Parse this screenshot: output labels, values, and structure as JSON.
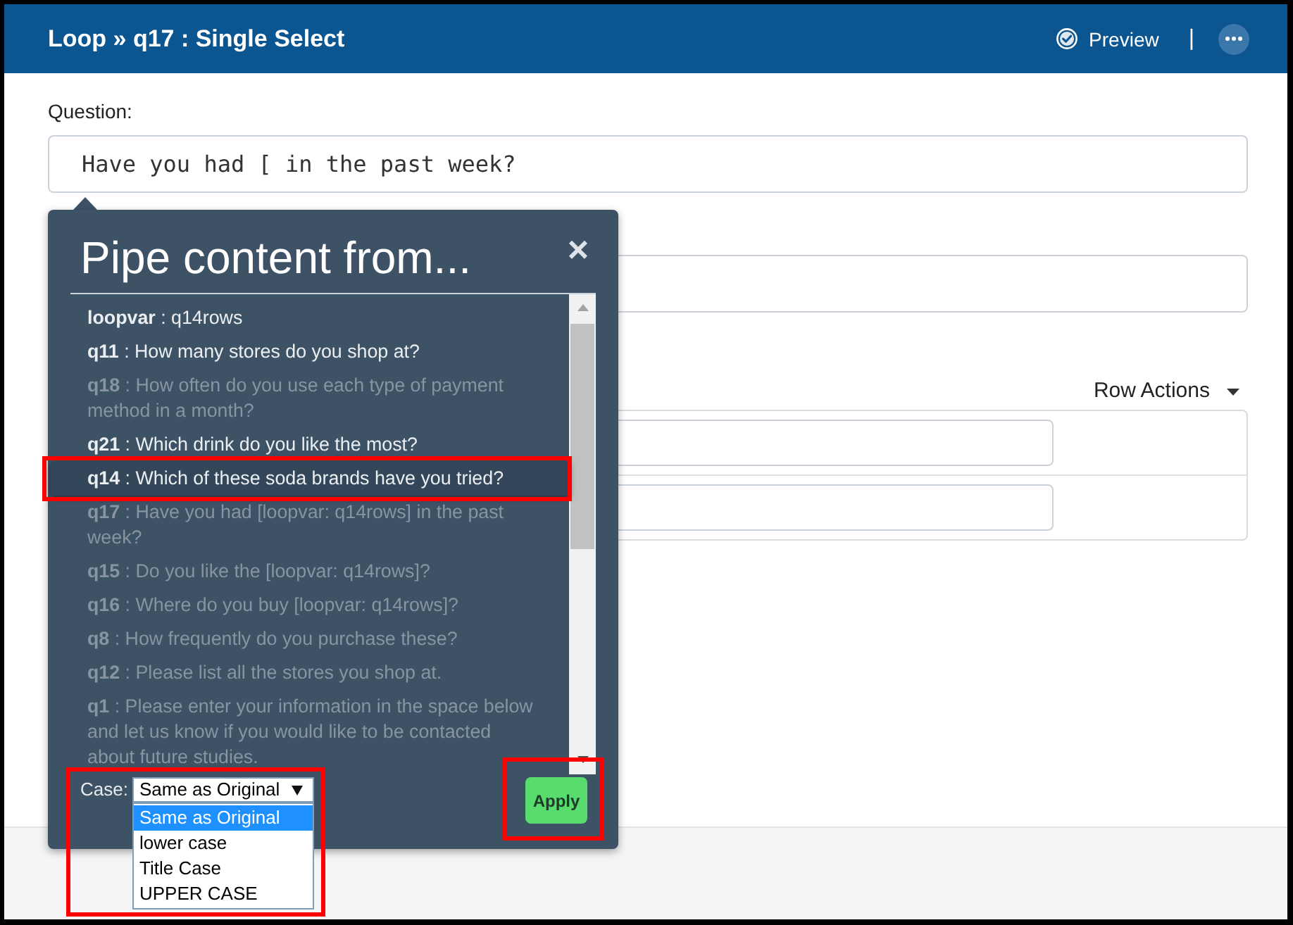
{
  "header": {
    "title": "Loop » q17 : Single Select",
    "preview": "Preview",
    "separator": "|"
  },
  "question": {
    "label": "Question:",
    "value": "Have you had [ in the past week?"
  },
  "row_actions": {
    "label": "Row Actions"
  },
  "pipe_popover": {
    "title": "Pipe content from...",
    "close": "×",
    "items": [
      {
        "label": "**loopvar** : q14rows",
        "disabled": false,
        "selected": false,
        "highlight_frame": false
      },
      {
        "label": "**q11** : How many stores do you shop at?",
        "disabled": false,
        "selected": false,
        "highlight_frame": false
      },
      {
        "label": "**q18** : How often do you use each type of payment method in a month?",
        "disabled": true,
        "selected": false,
        "highlight_frame": false
      },
      {
        "label": "**q21** : Which drink do you like the most?",
        "disabled": false,
        "selected": false,
        "highlight_frame": false
      },
      {
        "label": "**q14** : Which of these soda brands have you tried?",
        "disabled": false,
        "selected": true,
        "highlight_frame": true
      },
      {
        "label": "**q17** : Have you had [loopvar: q14rows] in the past week?",
        "disabled": true,
        "selected": false,
        "highlight_frame": false
      },
      {
        "label": "**q15** : Do you like the [loopvar: q14rows]?",
        "disabled": true,
        "selected": false,
        "highlight_frame": false
      },
      {
        "label": "**q16** : Where do you buy [loopvar: q14rows]?",
        "disabled": true,
        "selected": false,
        "highlight_frame": false
      },
      {
        "label": "**q8** : How frequently do you purchase these?",
        "disabled": true,
        "selected": false,
        "highlight_frame": false
      },
      {
        "label": "**q12** : Please list all the stores you shop at.",
        "disabled": true,
        "selected": false,
        "highlight_frame": false
      },
      {
        "label": "**q1** : Please enter your information in the space below and let us know if you would like to be contacted about future studies.",
        "disabled": true,
        "selected": false,
        "highlight_frame": false
      }
    ],
    "case": {
      "label": "Case:",
      "value": "Same as Original",
      "expanded": true,
      "highlight_frame": true,
      "options": [
        {
          "label": "Same as Original",
          "selected": true
        },
        {
          "label": "lower case",
          "selected": false
        },
        {
          "label": "Title Case",
          "selected": false
        },
        {
          "label": "UPPER CASE",
          "selected": false
        }
      ]
    },
    "apply": {
      "label": "Apply",
      "highlight_frame": true
    }
  }
}
